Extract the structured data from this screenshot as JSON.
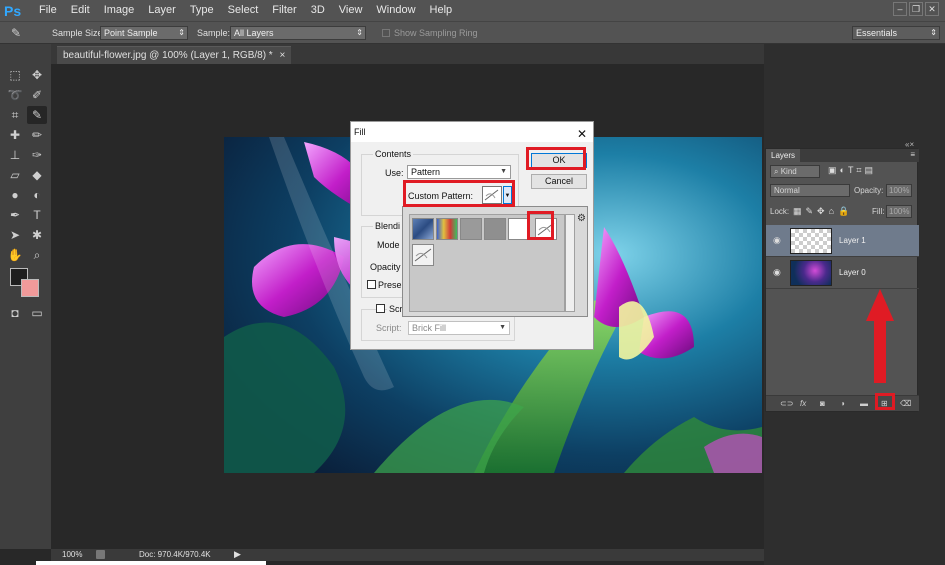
{
  "app": {
    "logo": "Ps",
    "workspace": "Essentials"
  },
  "menu": [
    "File",
    "Edit",
    "Image",
    "Layer",
    "Type",
    "Select",
    "Filter",
    "3D",
    "View",
    "Window",
    "Help"
  ],
  "options_bar": {
    "sample_size_label": "Sample Size:",
    "sample_size_value": "Point Sample",
    "sample_label": "Sample:",
    "sample_value": "All Layers",
    "sampling_ring_label": "Show Sampling Ring"
  },
  "document_tab": {
    "title": "beautiful-flower.jpg @ 100% (Layer 1, RGB/8) *",
    "close": "×"
  },
  "status": {
    "zoom": "100%",
    "doc": "Doc: 970.4K/970.4K"
  },
  "fill_dialog": {
    "title": "Fill",
    "contents_label": "Contents",
    "use_label": "Use:",
    "use_value": "Pattern",
    "custom_pattern_label": "Custom Pattern:",
    "blending_label": "Blendi",
    "mode_label": "Mode",
    "opacity_label": "Opacity",
    "preserve_label": "Prese",
    "script_check_label": "Scr",
    "script_label": "Script:",
    "script_value": "Brick Fill",
    "ok_label": "OK",
    "cancel_label": "Cancel"
  },
  "layers_panel": {
    "tab_label": "Layers",
    "kind_label": "Kind",
    "blend_mode": "Normal",
    "opacity_label": "Opacity:",
    "opacity_value": "100%",
    "lock_label": "Lock:",
    "fill_label": "Fill:",
    "fill_value": "100%",
    "layers": [
      {
        "name": "Layer 1",
        "selected": true
      },
      {
        "name": "Layer 0",
        "selected": false
      }
    ],
    "footer_icons": [
      "link-icon",
      "fx-icon",
      "mask-icon",
      "adjustment-icon",
      "folder-icon",
      "new-layer-icon",
      "trash-icon"
    ]
  },
  "colors": {
    "highlight_red": "#e01b24",
    "foreground": "#1f1f1f",
    "background": "#f19a9a",
    "accent_blue": "#31a8ff"
  }
}
